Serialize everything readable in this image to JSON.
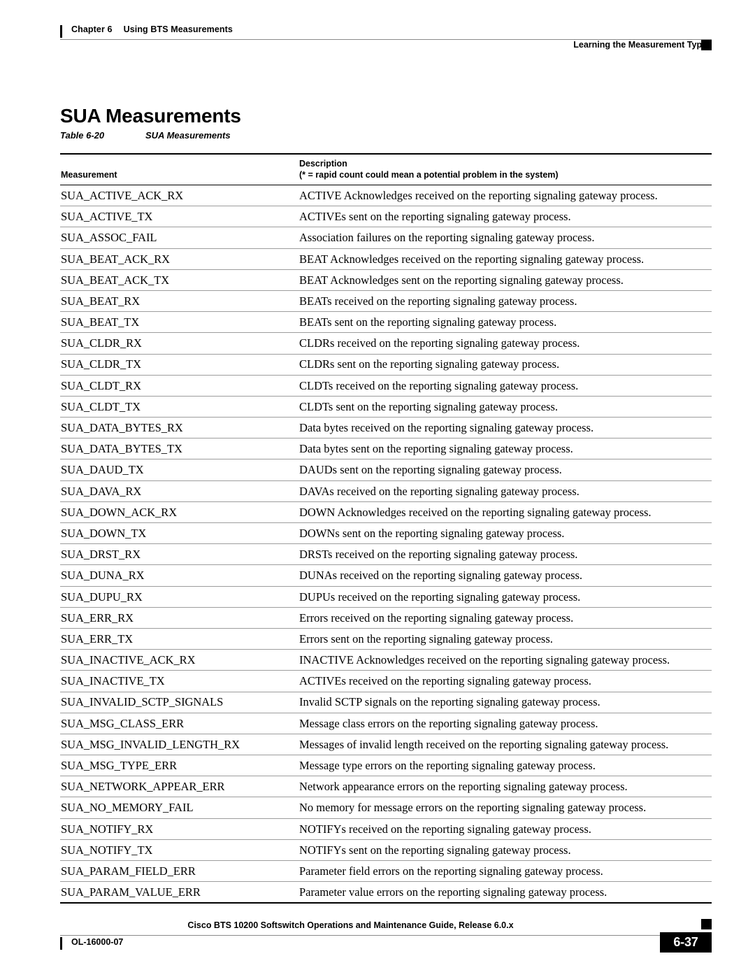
{
  "header": {
    "left_chapter": "Chapter 6",
    "left_title": "Using BTS Measurements",
    "right_title": "Learning the Measurement Types"
  },
  "section": {
    "title": "SUA Measurements"
  },
  "table_caption": {
    "number": "Table 6-20",
    "title": "SUA Measurements"
  },
  "table": {
    "columns": {
      "measurement": "Measurement",
      "description_line1": "Description",
      "description_line2": "(* = rapid count could mean a potential problem in the system)"
    },
    "rows": [
      {
        "measurement": "SUA_ACTIVE_ACK_RX",
        "description": "ACTIVE Acknowledges received on the reporting signaling gateway process."
      },
      {
        "measurement": "SUA_ACTIVE_TX",
        "description": "ACTIVEs sent on the reporting signaling gateway process."
      },
      {
        "measurement": "SUA_ASSOC_FAIL",
        "description": "Association failures on the reporting signaling gateway process."
      },
      {
        "measurement": "SUA_BEAT_ACK_RX",
        "description": "BEAT Acknowledges received on the reporting signaling gateway process."
      },
      {
        "measurement": "SUA_BEAT_ACK_TX",
        "description": "BEAT Acknowledges sent on the reporting signaling gateway process."
      },
      {
        "measurement": "SUA_BEAT_RX",
        "description": "BEATs received on the reporting signaling gateway process."
      },
      {
        "measurement": "SUA_BEAT_TX",
        "description": "BEATs sent on the reporting signaling gateway process."
      },
      {
        "measurement": "SUA_CLDR_RX",
        "description": "CLDRs received on the reporting signaling gateway process."
      },
      {
        "measurement": "SUA_CLDR_TX",
        "description": "CLDRs sent on the reporting signaling gateway process."
      },
      {
        "measurement": "SUA_CLDT_RX",
        "description": "CLDTs received on the reporting signaling gateway process."
      },
      {
        "measurement": "SUA_CLDT_TX",
        "description": "CLDTs sent on the reporting signaling gateway process."
      },
      {
        "measurement": "SUA_DATA_BYTES_RX",
        "description": "Data bytes received on the reporting signaling gateway process."
      },
      {
        "measurement": "SUA_DATA_BYTES_TX",
        "description": "Data bytes sent on the reporting signaling gateway process."
      },
      {
        "measurement": "SUA_DAUD_TX",
        "description": "DAUDs sent on the reporting signaling gateway process."
      },
      {
        "measurement": "SUA_DAVA_RX",
        "description": "DAVAs received on the reporting signaling gateway process."
      },
      {
        "measurement": "SUA_DOWN_ACK_RX",
        "description": "DOWN Acknowledges received on the reporting signaling gateway process."
      },
      {
        "measurement": "SUA_DOWN_TX",
        "description": "DOWNs sent on the reporting signaling gateway process."
      },
      {
        "measurement": "SUA_DRST_RX",
        "description": "DRSTs received on the reporting signaling gateway process."
      },
      {
        "measurement": "SUA_DUNA_RX",
        "description": "DUNAs received on the reporting signaling gateway process."
      },
      {
        "measurement": "SUA_DUPU_RX",
        "description": "DUPUs received on the reporting signaling gateway process."
      },
      {
        "measurement": "SUA_ERR_RX",
        "description": "Errors received on the reporting signaling gateway process."
      },
      {
        "measurement": "SUA_ERR_TX",
        "description": "Errors sent on the reporting signaling gateway process."
      },
      {
        "measurement": "SUA_INACTIVE_ACK_RX",
        "description": "INACTIVE Acknowledges received on the reporting signaling gateway process."
      },
      {
        "measurement": "SUA_INACTIVE_TX",
        "description": "ACTIVEs received on the reporting signaling gateway process."
      },
      {
        "measurement": "SUA_INVALID_SCTP_SIGNALS",
        "description": "Invalid SCTP signals on the reporting signaling gateway process."
      },
      {
        "measurement": "SUA_MSG_CLASS_ERR",
        "description": "Message class errors on the reporting signaling gateway process."
      },
      {
        "measurement": "SUA_MSG_INVALID_LENGTH_RX",
        "description": "Messages of invalid length received on the reporting signaling gateway process."
      },
      {
        "measurement": "SUA_MSG_TYPE_ERR",
        "description": "Message type errors on the reporting signaling gateway process."
      },
      {
        "measurement": "SUA_NETWORK_APPEAR_ERR",
        "description": "Network appearance errors on the reporting signaling gateway process."
      },
      {
        "measurement": "SUA_NO_MEMORY_FAIL",
        "description": "No memory for message errors on the reporting signaling gateway process."
      },
      {
        "measurement": "SUA_NOTIFY_RX",
        "description": "NOTIFYs received on the reporting signaling gateway process."
      },
      {
        "measurement": "SUA_NOTIFY_TX",
        "description": "NOTIFYs sent on the reporting signaling gateway process."
      },
      {
        "measurement": "SUA_PARAM_FIELD_ERR",
        "description": "Parameter field errors on the reporting signaling gateway process."
      },
      {
        "measurement": "SUA_PARAM_VALUE_ERR",
        "description": "Parameter value errors on the reporting signaling gateway process."
      }
    ]
  },
  "footer": {
    "book_title": "Cisco BTS 10200 Softswitch Operations and Maintenance Guide, Release 6.0.x",
    "doc_id": "OL-16000-07",
    "page_number": "6-37"
  }
}
